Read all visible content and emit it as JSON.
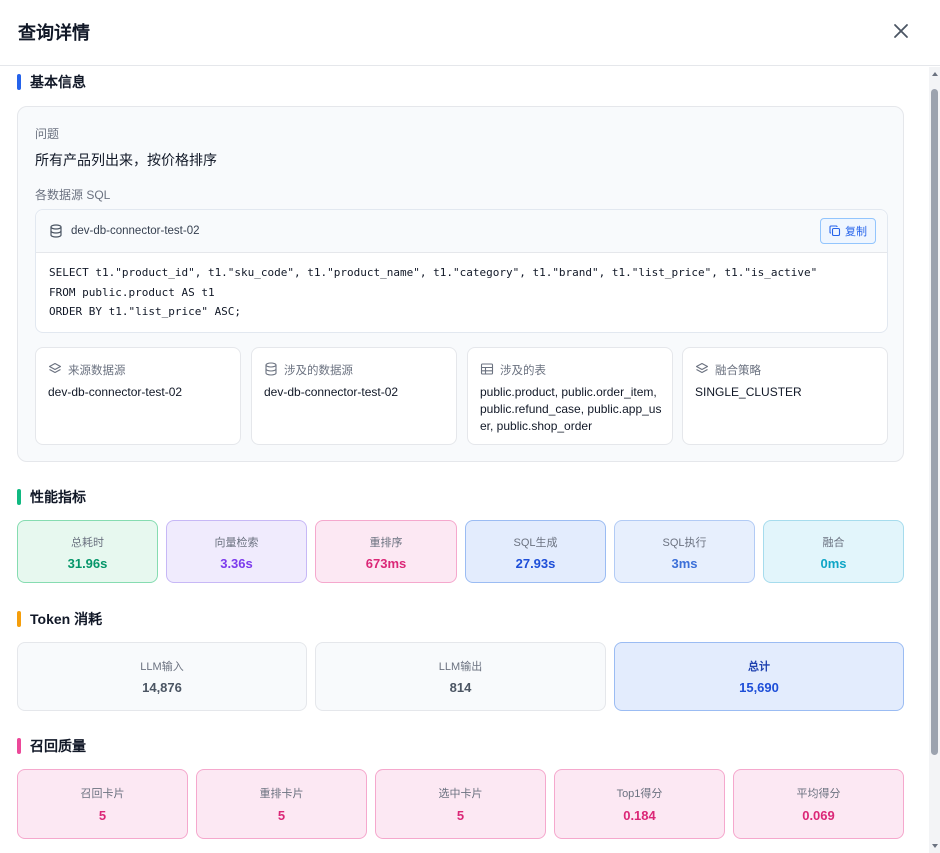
{
  "dialog": {
    "title": "查询详情"
  },
  "basic": {
    "section_title": "基本信息",
    "question_label": "问题",
    "question": "所有产品列出来，按价格排序",
    "sql_label": "各数据源 SQL",
    "sql_source": "dev-db-connector-test-02",
    "copy_label": "复制",
    "sql_lines": [
      "SELECT t1.\"product_id\", t1.\"sku_code\", t1.\"product_name\", t1.\"category\", t1.\"brand\", t1.\"list_price\", t1.\"is_active\"",
      "FROM public.product AS t1",
      "ORDER BY t1.\"list_price\" ASC;"
    ],
    "cards": [
      {
        "label": "来源数据源",
        "value": "dev-db-connector-test-02",
        "icon": "layers-icon"
      },
      {
        "label": "涉及的数据源",
        "value": "dev-db-connector-test-02",
        "icon": "database-icon"
      },
      {
        "label": "涉及的表",
        "value": "public.product, public.order_item, public.refund_case, public.app_user, public.shop_order",
        "icon": "table-icon"
      },
      {
        "label": "融合策略",
        "value": "SINGLE_CLUSTER",
        "icon": "layers-icon"
      }
    ]
  },
  "performance": {
    "section_title": "性能指标",
    "metrics": [
      {
        "label": "总耗时",
        "value": "31.96s"
      },
      {
        "label": "向量检索",
        "value": "3.36s"
      },
      {
        "label": "重排序",
        "value": "673ms"
      },
      {
        "label": "SQL生成",
        "value": "27.93s"
      },
      {
        "label": "SQL执行",
        "value": "3ms"
      },
      {
        "label": "融合",
        "value": "0ms"
      }
    ]
  },
  "tokens": {
    "section_title": "Token 消耗",
    "items": [
      {
        "label": "LLM输入",
        "value": "14,876"
      },
      {
        "label": "LLM输出",
        "value": "814"
      },
      {
        "label": "总计",
        "value": "15,690"
      }
    ]
  },
  "recall": {
    "section_title": "召回质量",
    "items": [
      {
        "label": "召回卡片",
        "value": "5"
      },
      {
        "label": "重排卡片",
        "value": "5"
      },
      {
        "label": "选中卡片",
        "value": "5"
      },
      {
        "label": "Top1得分",
        "value": "0.184"
      },
      {
        "label": "平均得分",
        "value": "0.069"
      }
    ]
  },
  "colors": {
    "basic_accent": "#2563eb",
    "performance_accent": "#10b981",
    "tokens_accent": "#f59e0b",
    "recall_accent": "#ec4899"
  }
}
